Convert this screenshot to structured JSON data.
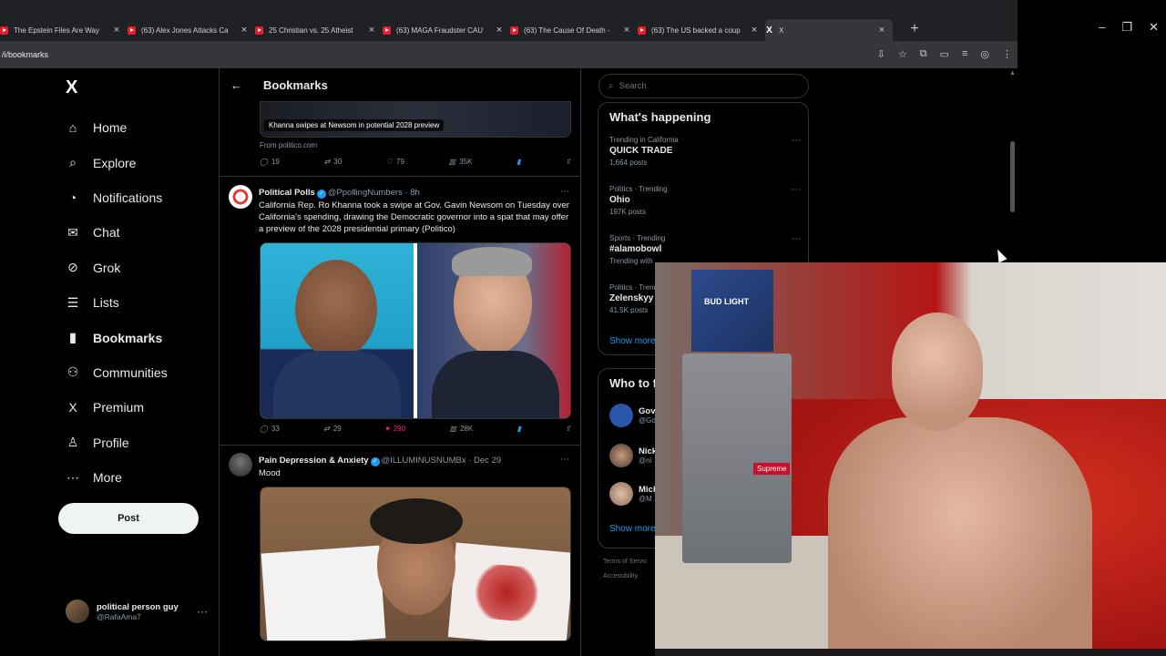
{
  "browser": {
    "tabs": [
      {
        "title": "The Epstein Files Are Way"
      },
      {
        "title": "(63) Alex Jones Attacks Ca"
      },
      {
        "title": "25 Christian vs. 25 Atheist"
      },
      {
        "title": "(63) MAGA Fraudster CAU"
      },
      {
        "title": "(63) The Cause Of Death -"
      },
      {
        "title": "(63) The US backed a coup"
      }
    ],
    "active_tab": {
      "icon": "X",
      "title": "X"
    },
    "new_tab": "+",
    "url": "/i/bookmarks"
  },
  "sidebar": {
    "logo": "X",
    "items": [
      {
        "label": "Home",
        "icon": "⌂"
      },
      {
        "label": "Explore",
        "icon": "⌕"
      },
      {
        "label": "Notifications",
        "icon": "◔"
      },
      {
        "label": "Chat",
        "icon": "✉"
      },
      {
        "label": "Grok",
        "icon": "⊘"
      },
      {
        "label": "Lists",
        "icon": "☰"
      },
      {
        "label": "Bookmarks",
        "icon": "▮"
      },
      {
        "label": "Communities",
        "icon": "⚇"
      },
      {
        "label": "Premium",
        "icon": "X"
      },
      {
        "label": "Profile",
        "icon": "♙"
      },
      {
        "label": "More",
        "icon": "⋯"
      }
    ],
    "post_button": "Post",
    "account": {
      "name": "political person guy",
      "handle": "@RafaAma7",
      "more": "···"
    }
  },
  "main": {
    "title": "Bookmarks",
    "back": "←",
    "prev_post": {
      "card_caption": "Khanna swipes at Newsom in potential 2028 preview",
      "source": "From politico.com",
      "replies": "19",
      "reposts": "30",
      "likes": "79",
      "views": "35K"
    },
    "post1": {
      "name": "Political Polls",
      "handle": "@PpollingNumbers · 8h",
      "text": "California Rep. Ro Khanna took a swipe at Gov. Gavin Newsom on Tuesday over California's spending, drawing the Democratic governor into a spat that may offer a preview of the 2028 presidential primary (Politico)",
      "replies": "33",
      "reposts": "29",
      "likes": "290",
      "views": "28K"
    },
    "post2": {
      "name": "Pain Depression & Anxiety",
      "handle": "@ILLUMINUSNUMBx · Dec 29",
      "text": "Mood"
    }
  },
  "right": {
    "search_placeholder": "Search",
    "happening_title": "What's happening",
    "trends": [
      {
        "context": "Trending in California",
        "name": "QUICK TRADE",
        "count": "1,664 posts"
      },
      {
        "context": "Politics · Trending",
        "name": "Ohio",
        "count": "197K posts"
      },
      {
        "context": "Sports · Trending",
        "name": "#alamobowl",
        "count": "Trending with"
      },
      {
        "context": "Politics · Trend",
        "name": "Zelenskyy",
        "count": "41.5K posts"
      }
    ],
    "show_more": "Show more",
    "who_title": "Who to f",
    "who": [
      {
        "name": "Gov",
        "handle": "@Go"
      },
      {
        "name": "Nick",
        "handle": "@ni"
      },
      {
        "name": "Mich",
        "handle": "@M"
      }
    ],
    "show_more2": "Show more",
    "footer1": "Terms of Servic",
    "footer2": "Accessibility"
  },
  "webcam": {
    "box_label": "BUD LIGHT",
    "sticker": "Supreme"
  }
}
